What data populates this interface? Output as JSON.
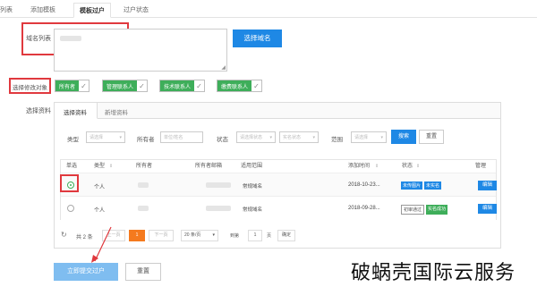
{
  "tabs": [
    "列表",
    "添加模板",
    "模板过户",
    "过户状态"
  ],
  "form": {
    "domain_list_label": "域名列表",
    "domain_list_value": "",
    "select_domain_button": "选择域名",
    "template_target_label": "选择修改对象",
    "targets": [
      "所有者",
      "管理联系人",
      "技术联系人",
      "缴费联系人"
    ],
    "check_glyph": "✓",
    "material_label": "选择资料"
  },
  "panel": {
    "tabs": [
      "选择资料",
      "新增资料"
    ],
    "filters": {
      "type_label": "类型",
      "type_placeholder": "请选择",
      "owner_label": "所有者",
      "owner_placeholder": "单位/姓名",
      "status_label": "状态",
      "status_placeholder_1": "请选择状态",
      "status_placeholder_2": "实名状态",
      "range_label": "范围",
      "range_placeholder": "请选择",
      "search_button": "搜索",
      "reset_button": "重置"
    },
    "table": {
      "headers": [
        "单选",
        "类型",
        "所有者",
        "所有者邮箱",
        "适用范围",
        "添加时间",
        "状态",
        "管理"
      ],
      "rows": [
        {
          "selected": true,
          "type": "个人",
          "scope": "常规域名",
          "time": "2018-10-23...",
          "status": [
            {
              "text": "未传图片",
              "style": "blue"
            },
            {
              "text": "未实名",
              "style": "blue"
            }
          ],
          "action": "编辑"
        },
        {
          "selected": false,
          "type": "个人",
          "scope": "常规域名",
          "time": "2018-09-28...",
          "status": [
            {
              "text": "初审通过",
              "style": "outline"
            },
            {
              "text": "实名成功",
              "style": "green"
            }
          ],
          "action": "编辑"
        }
      ]
    },
    "pagination": {
      "total": "共 2 条",
      "prev": "上一页",
      "page": "1",
      "next": "下一页",
      "page_size": "20 条/页",
      "goto_label": "到第",
      "goto_value": "1",
      "page_unit": "页",
      "confirm": "确定"
    }
  },
  "actions": {
    "submit": "立即提交过户",
    "reset": "重置"
  },
  "watermark": "破蜗壳国际云服务",
  "colors": {
    "accent": "#1e88e5",
    "green": "#3eae5a",
    "highlight": "#e0393e",
    "orange": "#f57a1e"
  }
}
